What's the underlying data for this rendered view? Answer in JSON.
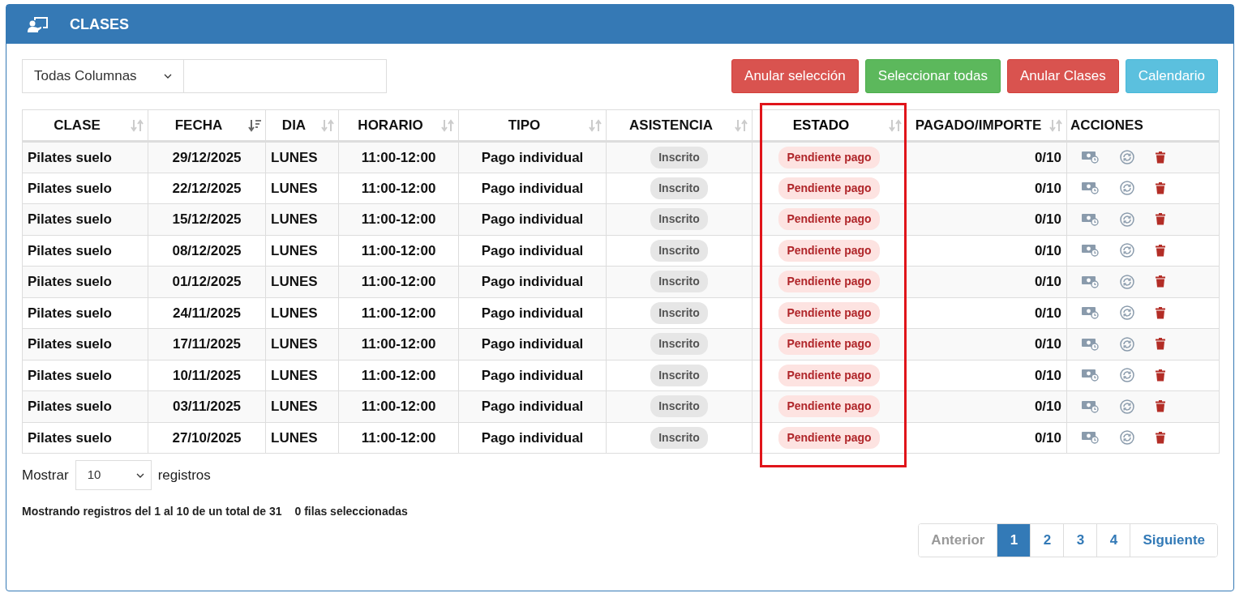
{
  "panel": {
    "title": "CLASES"
  },
  "filter": {
    "column_select": "Todas Columnas"
  },
  "buttons": [
    {
      "label": "Anular selección",
      "kind": "danger"
    },
    {
      "label": "Seleccionar todas",
      "kind": "success"
    },
    {
      "label": "Anular Clases",
      "kind": "danger"
    },
    {
      "label": "Calendario",
      "kind": "info"
    }
  ],
  "table": {
    "columns": [
      {
        "label": "CLASE",
        "sorted": false,
        "highlighted": false
      },
      {
        "label": "FECHA",
        "sorted": true,
        "highlighted": false
      },
      {
        "label": "DIA",
        "sorted": false,
        "highlighted": false
      },
      {
        "label": "HORARIO",
        "sorted": false,
        "highlighted": false
      },
      {
        "label": "TIPO",
        "sorted": false,
        "highlighted": false
      },
      {
        "label": "ASISTENCIA",
        "sorted": false,
        "highlighted": false
      },
      {
        "label": "ESTADO",
        "sorted": false,
        "highlighted": true
      },
      {
        "label": "PAGADO/IMPORTE",
        "sorted": false,
        "highlighted": false
      },
      {
        "label": "ACCIONES",
        "highlighted": false
      }
    ],
    "rows": [
      {
        "clase": "Pilates suelo",
        "fecha": "29/12/2025",
        "dia": "LUNES",
        "horario": "11:00-12:00",
        "tipo": "Pago individual",
        "asistencia": "Inscrito",
        "estado": "Pendiente pago",
        "pagado": "0/10"
      },
      {
        "clase": "Pilates suelo",
        "fecha": "22/12/2025",
        "dia": "LUNES",
        "horario": "11:00-12:00",
        "tipo": "Pago individual",
        "asistencia": "Inscrito",
        "estado": "Pendiente pago",
        "pagado": "0/10"
      },
      {
        "clase": "Pilates suelo",
        "fecha": "15/12/2025",
        "dia": "LUNES",
        "horario": "11:00-12:00",
        "tipo": "Pago individual",
        "asistencia": "Inscrito",
        "estado": "Pendiente pago",
        "pagado": "0/10"
      },
      {
        "clase": "Pilates suelo",
        "fecha": "08/12/2025",
        "dia": "LUNES",
        "horario": "11:00-12:00",
        "tipo": "Pago individual",
        "asistencia": "Inscrito",
        "estado": "Pendiente pago",
        "pagado": "0/10"
      },
      {
        "clase": "Pilates suelo",
        "fecha": "01/12/2025",
        "dia": "LUNES",
        "horario": "11:00-12:00",
        "tipo": "Pago individual",
        "asistencia": "Inscrito",
        "estado": "Pendiente pago",
        "pagado": "0/10"
      },
      {
        "clase": "Pilates suelo",
        "fecha": "24/11/2025",
        "dia": "LUNES",
        "horario": "11:00-12:00",
        "tipo": "Pago individual",
        "asistencia": "Inscrito",
        "estado": "Pendiente pago",
        "pagado": "0/10"
      },
      {
        "clase": "Pilates suelo",
        "fecha": "17/11/2025",
        "dia": "LUNES",
        "horario": "11:00-12:00",
        "tipo": "Pago individual",
        "asistencia": "Inscrito",
        "estado": "Pendiente pago",
        "pagado": "0/10"
      },
      {
        "clase": "Pilates suelo",
        "fecha": "10/11/2025",
        "dia": "LUNES",
        "horario": "11:00-12:00",
        "tipo": "Pago individual",
        "asistencia": "Inscrito",
        "estado": "Pendiente pago",
        "pagado": "0/10"
      },
      {
        "clase": "Pilates suelo",
        "fecha": "03/11/2025",
        "dia": "LUNES",
        "horario": "11:00-12:00",
        "tipo": "Pago individual",
        "asistencia": "Inscrito",
        "estado": "Pendiente pago",
        "pagado": "0/10"
      },
      {
        "clase": "Pilates suelo",
        "fecha": "27/10/2025",
        "dia": "LUNES",
        "horario": "11:00-12:00",
        "tipo": "Pago individual",
        "asistencia": "Inscrito",
        "estado": "Pendiente pago",
        "pagado": "0/10"
      }
    ]
  },
  "length_menu": {
    "before": "Mostrar",
    "value": "10",
    "after": "registros"
  },
  "info": {
    "records": "Mostrando registros del 1 al 10 de un total de 31",
    "selected": "0 filas seleccionadas"
  },
  "pagination": [
    {
      "label": "Anterior",
      "selected": false,
      "disabled": true
    },
    {
      "label": "1",
      "selected": true,
      "disabled": false
    },
    {
      "label": "2",
      "selected": false,
      "disabled": false
    },
    {
      "label": "3",
      "selected": false,
      "disabled": false
    },
    {
      "label": "4",
      "selected": false,
      "disabled": false
    },
    {
      "label": "Siguiente",
      "selected": false,
      "disabled": false
    }
  ]
}
